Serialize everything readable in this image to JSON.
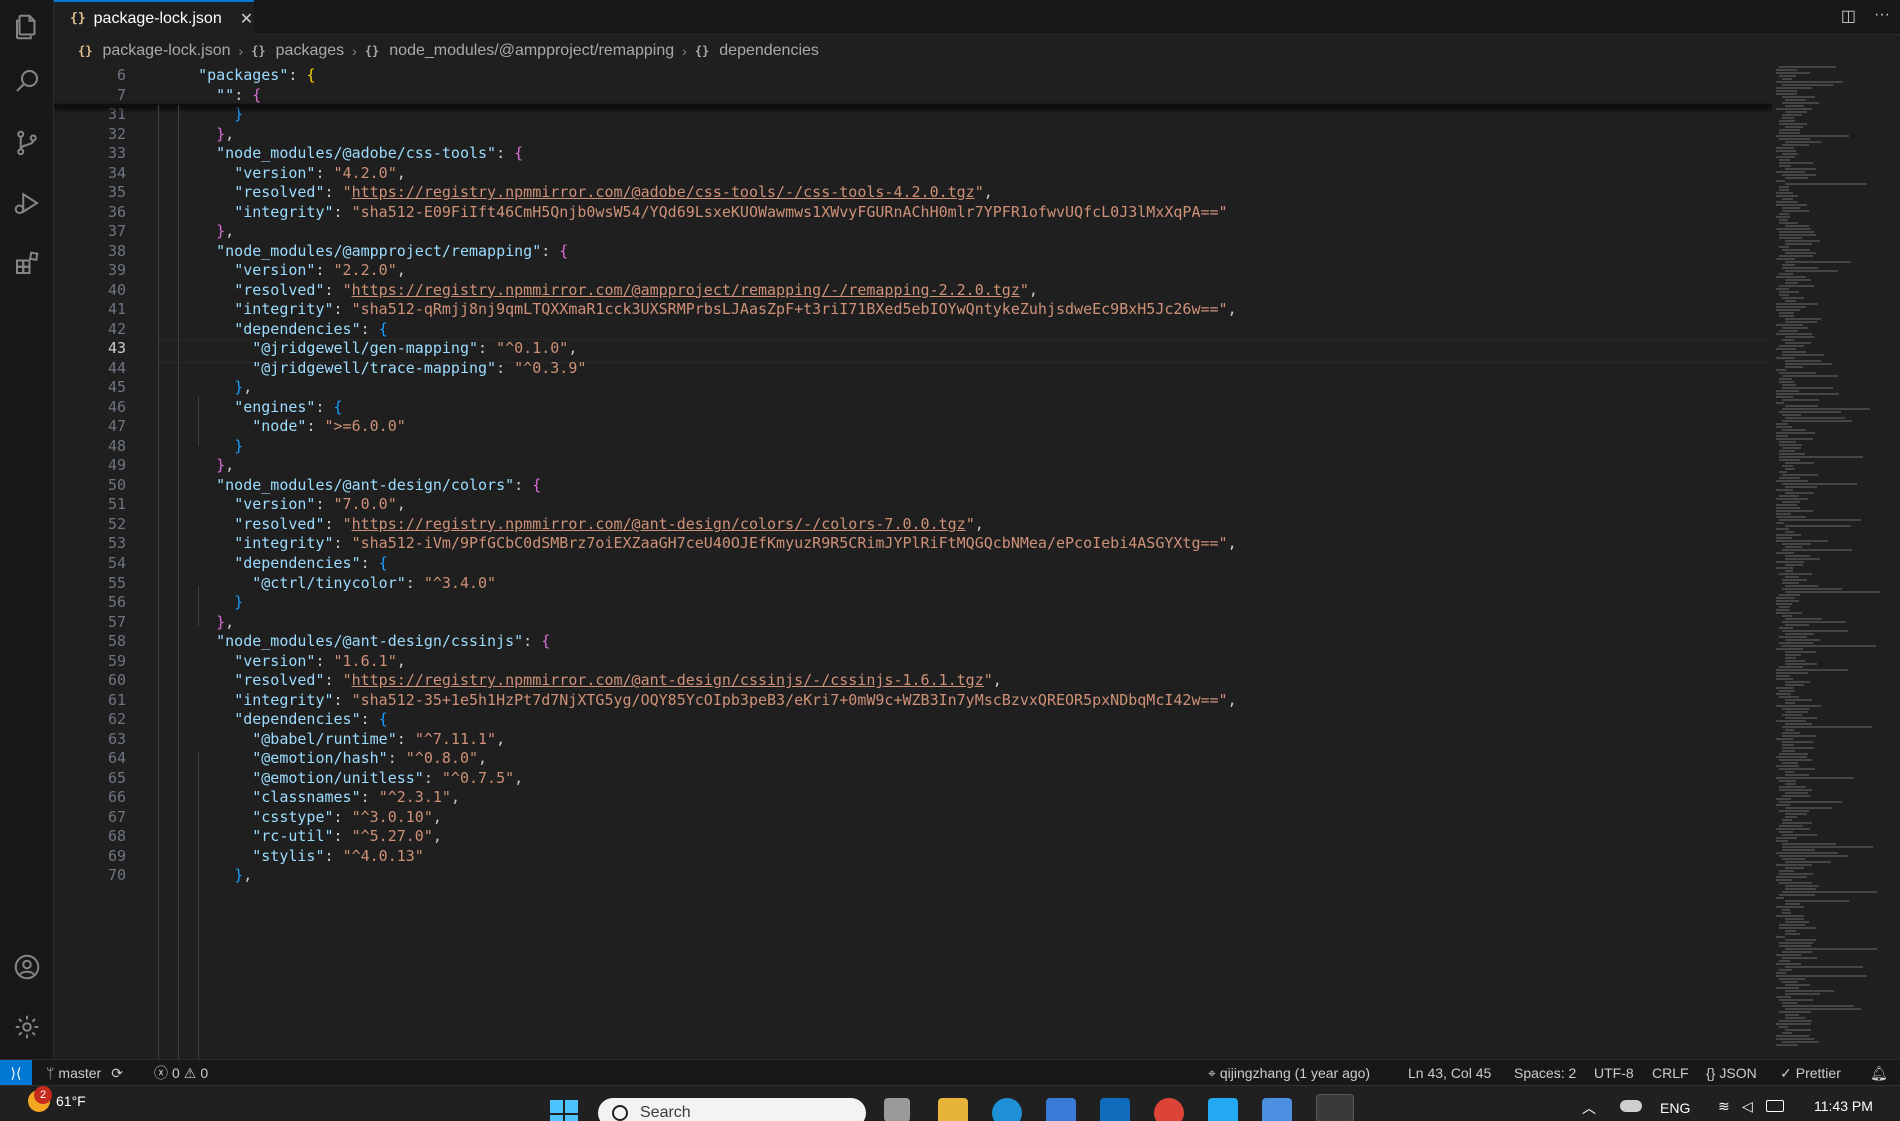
{
  "tab": {
    "icon": "{}",
    "label": "package-lock.json",
    "close": "✕"
  },
  "breadcrumb": [
    {
      "icon": "{}",
      "label": "package-lock.json"
    },
    {
      "icon": "{}",
      "label": "packages"
    },
    {
      "icon": "{}",
      "label": "node_modules/@ampproject/remapping"
    },
    {
      "icon": "{}",
      "label": "dependencies"
    }
  ],
  "editor": {
    "active_line": "43",
    "lines": [
      {
        "n": "6",
        "t": "  \"packages\": {"
      },
      {
        "n": "7",
        "t": "    \"\": {"
      },
      {
        "n": "31",
        "t": "      }"
      },
      {
        "n": "32",
        "t": "    },"
      },
      {
        "n": "33",
        "t": "    \"node_modules/@adobe/css-tools\": {"
      },
      {
        "n": "34",
        "t": "      \"version\": \"4.2.0\","
      },
      {
        "n": "35",
        "t": "      \"resolved\": \"https://registry.npmmirror.com/@adobe/css-tools/-/css-tools-4.2.0.tgz\","
      },
      {
        "n": "36",
        "t": "      \"integrity\": \"sha512-E09FiIft46CmH5Qnjb0wsW54/YQd69LsxeKUOWawmws1XWvyFGURnAChH0mlr7YPFR1ofwvUQfcL0J3lMxXqPA==\""
      },
      {
        "n": "37",
        "t": "    },"
      },
      {
        "n": "38",
        "t": "    \"node_modules/@ampproject/remapping\": {"
      },
      {
        "n": "39",
        "t": "      \"version\": \"2.2.0\","
      },
      {
        "n": "40",
        "t": "      \"resolved\": \"https://registry.npmmirror.com/@ampproject/remapping/-/remapping-2.2.0.tgz\","
      },
      {
        "n": "41",
        "t": "      \"integrity\": \"sha512-qRmjj8nj9qmLTQXXmaR1cck3UXSRMPrbsLJAasZpF+t3riI71BXed5ebIOYwQntykeZuhjsdweEc9BxH5Jc26w==\","
      },
      {
        "n": "42",
        "t": "      \"dependencies\": {"
      },
      {
        "n": "43",
        "t": "        \"@jridgewell/gen-mapping\": \"^0.1.0\","
      },
      {
        "n": "44",
        "t": "        \"@jridgewell/trace-mapping\": \"^0.3.9\""
      },
      {
        "n": "45",
        "t": "      },"
      },
      {
        "n": "46",
        "t": "      \"engines\": {"
      },
      {
        "n": "47",
        "t": "        \"node\": \">=6.0.0\""
      },
      {
        "n": "48",
        "t": "      }"
      },
      {
        "n": "49",
        "t": "    },"
      },
      {
        "n": "50",
        "t": "    \"node_modules/@ant-design/colors\": {"
      },
      {
        "n": "51",
        "t": "      \"version\": \"7.0.0\","
      },
      {
        "n": "52",
        "t": "      \"resolved\": \"https://registry.npmmirror.com/@ant-design/colors/-/colors-7.0.0.tgz\","
      },
      {
        "n": "53",
        "t": "      \"integrity\": \"sha512-iVm/9PfGCbC0dSMBrz7oiEXZaaGH7ceU40OJEfKmyuzR9R5CRimJYPlRiFtMQGQcbNMea/ePcoIebi4ASGYXtg==\","
      },
      {
        "n": "54",
        "t": "      \"dependencies\": {"
      },
      {
        "n": "55",
        "t": "        \"@ctrl/tinycolor\": \"^3.4.0\""
      },
      {
        "n": "56",
        "t": "      }"
      },
      {
        "n": "57",
        "t": "    },"
      },
      {
        "n": "58",
        "t": "    \"node_modules/@ant-design/cssinjs\": {"
      },
      {
        "n": "59",
        "t": "      \"version\": \"1.6.1\","
      },
      {
        "n": "60",
        "t": "      \"resolved\": \"https://registry.npmmirror.com/@ant-design/cssinjs/-/cssinjs-1.6.1.tgz\","
      },
      {
        "n": "61",
        "t": "      \"integrity\": \"sha512-35+1e5h1HzPt7d7NjXTG5yg/OQY85YcOIpb3peB3/eKri7+0mW9c+WZB3In7yMscBzvxQREOR5pxNDbqMcI42w==\","
      },
      {
        "n": "62",
        "t": "      \"dependencies\": {"
      },
      {
        "n": "63",
        "t": "        \"@babel/runtime\": \"^7.11.1\","
      },
      {
        "n": "64",
        "t": "        \"@emotion/hash\": \"^0.8.0\","
      },
      {
        "n": "65",
        "t": "        \"@emotion/unitless\": \"^0.7.5\","
      },
      {
        "n": "66",
        "t": "        \"classnames\": \"^2.3.1\","
      },
      {
        "n": "67",
        "t": "        \"csstype\": \"^3.0.10\","
      },
      {
        "n": "68",
        "t": "        \"rc-util\": \"^5.27.0\","
      },
      {
        "n": "69",
        "t": "        \"stylis\": \"^4.0.13\""
      },
      {
        "n": "70",
        "t": "      },"
      }
    ]
  },
  "status_bar": {
    "branch": "master",
    "errors": "0",
    "warnings": "0",
    "blame": "qijingzhang (1 year ago)",
    "position": "Ln 43, Col 45",
    "spaces": "Spaces: 2",
    "encoding": "UTF-8",
    "eol": "CRLF",
    "language": "JSON",
    "formatter": "Prettier"
  },
  "taskbar": {
    "notification_count": "2",
    "weather": "61°F",
    "search_placeholder": "Search",
    "language": "ENG",
    "time": "11:43 PM"
  },
  "colors": {
    "accent": "#0078d4",
    "key": "#9cdcfe",
    "string": "#ce9178",
    "bracket_gold": "#ffd700",
    "bracket_purple": "#da70d6",
    "bracket_blue": "#179fff"
  },
  "icons": [
    "explorer-icon",
    "search-icon",
    "source-control-icon",
    "run-debug-icon",
    "extensions-icon",
    "accounts-icon",
    "settings-gear-icon",
    "split-editor-icon",
    "more-actions-icon"
  ]
}
